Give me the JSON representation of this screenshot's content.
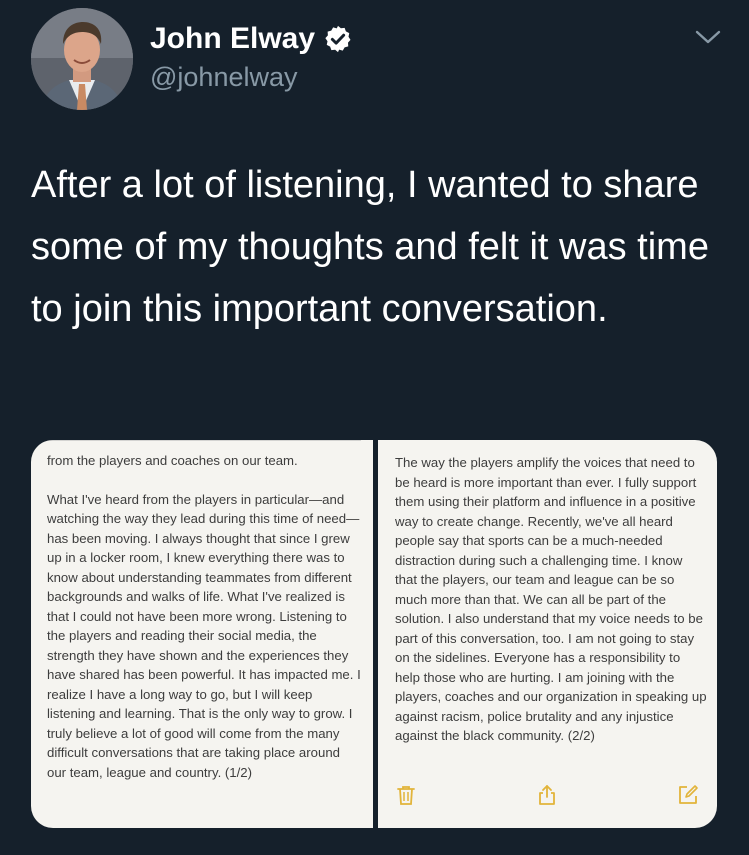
{
  "author": {
    "name": "John Elway",
    "handle": "@johnelway",
    "verified": true,
    "avatar": "profile-photo"
  },
  "tweet": {
    "text": "After a lot of listening, I wanted to share some of my thoughts and felt it was time to join this important conversation."
  },
  "notes": {
    "left": {
      "top_line": "from the players and coaches on our team.",
      "paragraph": "What I've heard from the players in particular—and watching the way they lead during this time of need—has been moving. I always thought that since I grew up in a locker room, I knew everything there was to know about understanding teammates from different backgrounds and walks of life. What I've realized is that I could not have been more wrong. Listening to the players and reading their social media, the strength they have shown and the experiences they have shared has been powerful. It has impacted me. I realize I have a long way to go, but I will keep listening and learning. That is the only way to grow. I truly believe a lot of good will come from the many difficult conversations that are taking place around our team, league and country. (1/2)"
    },
    "right": {
      "paragraph": "The way the players amplify the voices that need to be heard is more important than ever. I fully support them using their platform and influence in a positive way to create change. Recently, we've all heard people say that sports can be a much-needed distraction during such a challenging time. I know that the players, our team and league can be so much more than that. We can all be part of the solution. I also understand that my voice needs to be part of this conversation, too. I am not going to stay on the sidelines. Everyone has a responsibility to help those who are hurting. I am joining with the players, coaches and our organization in speaking up against racism, police brutality and any injustice against the black community. (2/2)"
    },
    "toolbar_icons": [
      "trash-icon",
      "share-icon",
      "compose-icon"
    ]
  },
  "colors": {
    "background": "#15202b",
    "text_primary": "#ffffff",
    "text_secondary": "#8899a6",
    "note_background": "#f5f4f0",
    "note_text": "#3d3d3d",
    "toolbar_icon": "#e2b43a"
  }
}
